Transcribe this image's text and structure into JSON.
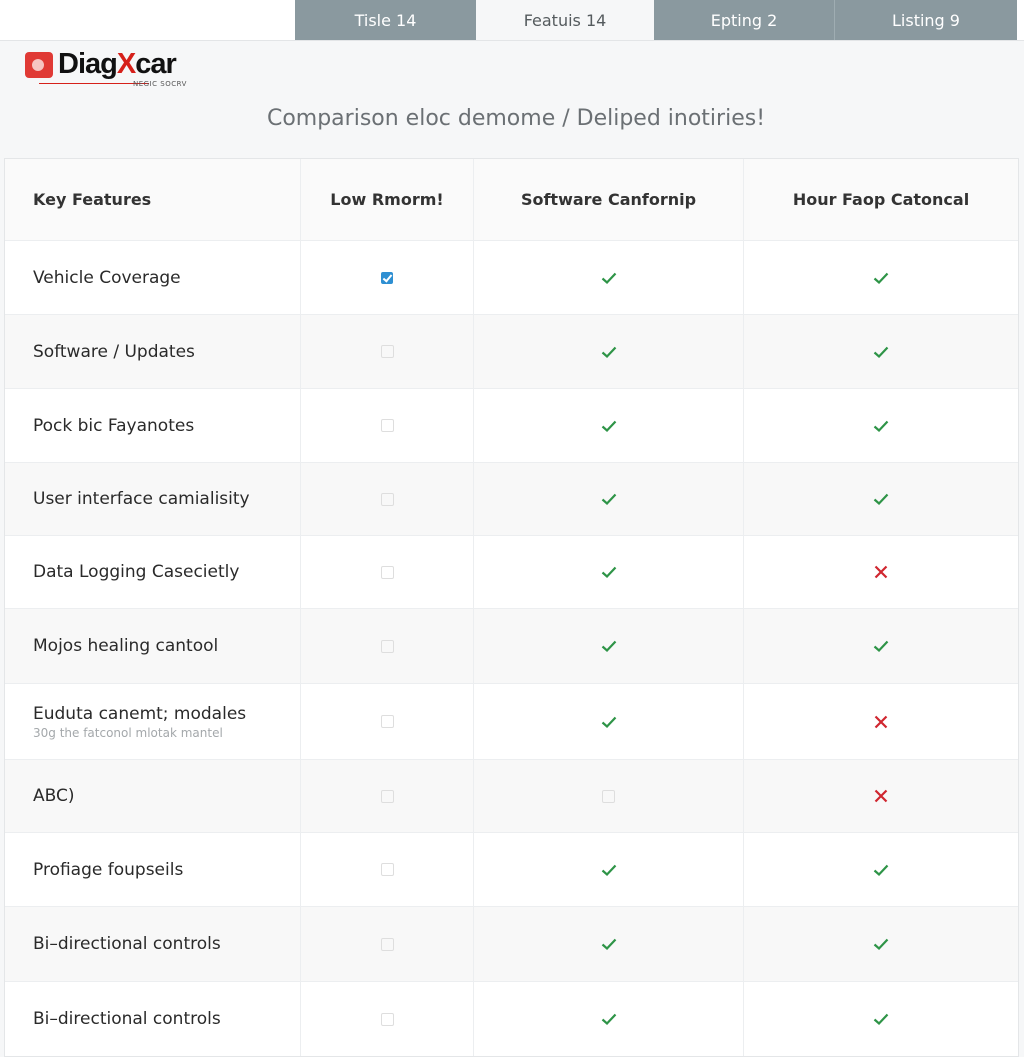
{
  "tabs": [
    {
      "label": "Tisle 14",
      "active": false
    },
    {
      "label": "Featuis 14",
      "active": true
    },
    {
      "label": "Epting 2",
      "active": false
    },
    {
      "label": "Listing 9",
      "active": false
    }
  ],
  "brand": {
    "name_part1": "Diag",
    "name_x": "X",
    "name_part2": "car",
    "tagline": "NEGIC SOCRV",
    "colors": {
      "accent": "#d6201a"
    }
  },
  "subtitle": "Comparison eloc demome / Deliped inotiries!",
  "table": {
    "headers": [
      "Key Features",
      "Low Rmorm!",
      "Software Canfornip",
      "Hour Faop Catoncal"
    ],
    "rows": [
      {
        "feature": "Vehicle Coverage",
        "sub": "",
        "values": [
          "checkbox-checked",
          "check",
          "check"
        ]
      },
      {
        "feature": "Software / Updates",
        "sub": "",
        "values": [
          "checkbox-empty",
          "check",
          "check"
        ]
      },
      {
        "feature": "Pock bic Fayanotes",
        "sub": "",
        "values": [
          "checkbox-empty",
          "check",
          "check"
        ]
      },
      {
        "feature": "User interface camialisity",
        "sub": "",
        "values": [
          "checkbox-empty",
          "check",
          "check"
        ]
      },
      {
        "feature": "Data Logging Casecietly",
        "sub": "",
        "values": [
          "checkbox-empty",
          "check",
          "cross"
        ]
      },
      {
        "feature": "Mojos healing cantool",
        "sub": "",
        "values": [
          "checkbox-empty",
          "check",
          "check"
        ]
      },
      {
        "feature": "Euduta canemt; modales",
        "sub": "30g the fatconol mlotak mantel",
        "values": [
          "checkbox-empty",
          "check",
          "cross"
        ]
      },
      {
        "feature": "ABC)",
        "sub": "",
        "values": [
          "checkbox-empty",
          "checkbox-empty",
          "cross"
        ]
      },
      {
        "feature": "Profiage foupseils",
        "sub": "",
        "values": [
          "checkbox-empty",
          "check",
          "check"
        ]
      },
      {
        "feature": "Bi–directional controls",
        "sub": "",
        "values": [
          "checkbox-empty",
          "check",
          "check"
        ]
      },
      {
        "feature": "Bi–directional controls",
        "sub": "",
        "values": [
          "checkbox-empty",
          "check",
          "check"
        ]
      }
    ]
  },
  "colors": {
    "check": "#2e9447",
    "cross": "#d0262f",
    "checkbox": "#2e8fd2"
  }
}
